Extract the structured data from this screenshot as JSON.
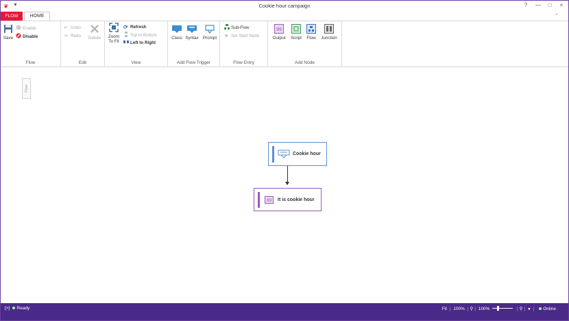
{
  "window": {
    "title": "Cookie hour campaign"
  },
  "window_controls": {
    "help": "?",
    "minimize": "—",
    "maximize": "□",
    "close": "×"
  },
  "tabs": [
    {
      "label": "FLOW",
      "active": false
    },
    {
      "label": "HOME",
      "active": true
    }
  ],
  "ribbon": {
    "flow_group": {
      "label": "Flow",
      "save": "Save",
      "enable": "Enable",
      "disable": "Disable"
    },
    "edit_group": {
      "label": "Edit",
      "undo": "Undo",
      "redo": "Redo",
      "delete": "Delete"
    },
    "view_group": {
      "label": "View",
      "zoom_line1": "Zoom",
      "zoom_line2": "To Fit",
      "refresh": "Refresh",
      "top_to_bottom": "Top to Bottom",
      "left_to_right": "Left to Right"
    },
    "trigger_group": {
      "label": "Add Flow Trigger",
      "class": "Class",
      "syntax": "Syntax",
      "prompt": "Prompt"
    },
    "entry_group": {
      "label": "Flow Entry",
      "sub_flow": "Sub-Flow",
      "set_start_node": "Set Start Node"
    },
    "node_group": {
      "label": "Add Node",
      "output": "Output",
      "script": "Script",
      "flow": "Flow",
      "junction": "Junction"
    }
  },
  "canvas": {
    "side_tab": "Flow",
    "nodes": [
      {
        "label": "Cookie hour",
        "kind": "prompt",
        "accent": "#5b8fd6"
      },
      {
        "label": "It is cookie hour",
        "kind": "output",
        "accent": "#9b59b6"
      }
    ]
  },
  "status": {
    "state": "Ready",
    "fit": "Fit",
    "zoom_a": "100%",
    "zoom_b": "100%",
    "connection": "Online"
  },
  "colors": {
    "accent": "#e8173a",
    "statusbar": "#4a2a88",
    "output_node": "#9b59b6",
    "prompt_node": "#5b8fd6"
  }
}
